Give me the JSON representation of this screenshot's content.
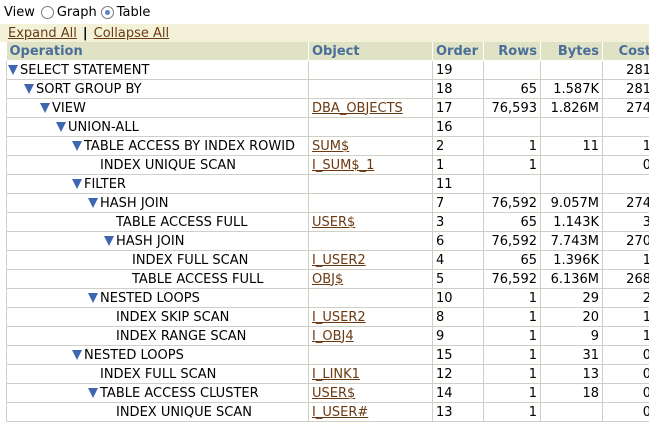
{
  "view": {
    "label": "View",
    "options": [
      {
        "label": "Graph",
        "selected": false
      },
      {
        "label": "Table",
        "selected": true
      }
    ]
  },
  "links": {
    "expand_all": "Expand All",
    "separator": "|",
    "collapse_all": "Collapse All"
  },
  "columns": [
    "Operation",
    "Object",
    "Order",
    "Rows",
    "Bytes",
    "Cost"
  ],
  "rows": [
    {
      "op": "SELECT STATEMENT",
      "depth": 0,
      "expandable": true,
      "object": "",
      "order": "19",
      "rows": "",
      "bytes": "",
      "cost": "281"
    },
    {
      "op": "SORT GROUP BY",
      "depth": 1,
      "expandable": true,
      "object": "",
      "order": "18",
      "rows": "65",
      "bytes": "1.587K",
      "cost": "281"
    },
    {
      "op": "VIEW",
      "depth": 2,
      "expandable": true,
      "object": "DBA_OBJECTS",
      "order": "17",
      "rows": "76,593",
      "bytes": "1.826M",
      "cost": "274"
    },
    {
      "op": "UNION-ALL",
      "depth": 3,
      "expandable": true,
      "object": "",
      "order": "16",
      "rows": "",
      "bytes": "",
      "cost": ""
    },
    {
      "op": "TABLE ACCESS BY INDEX ROWID",
      "depth": 4,
      "expandable": true,
      "object": "SUM$",
      "order": "2",
      "rows": "1",
      "bytes": "11",
      "cost": "1"
    },
    {
      "op": "INDEX UNIQUE SCAN",
      "depth": 5,
      "expandable": false,
      "object": "I_SUM$_1",
      "order": "1",
      "rows": "1",
      "bytes": "",
      "cost": "0"
    },
    {
      "op": "FILTER",
      "depth": 4,
      "expandable": true,
      "object": "",
      "order": "11",
      "rows": "",
      "bytes": "",
      "cost": ""
    },
    {
      "op": "HASH JOIN",
      "depth": 5,
      "expandable": true,
      "object": "",
      "order": "7",
      "rows": "76,592",
      "bytes": "9.057M",
      "cost": "274"
    },
    {
      "op": "TABLE ACCESS FULL",
      "depth": 6,
      "expandable": false,
      "object": "USER$",
      "order": "3",
      "rows": "65",
      "bytes": "1.143K",
      "cost": "3"
    },
    {
      "op": "HASH JOIN",
      "depth": 6,
      "expandable": true,
      "object": "",
      "order": "6",
      "rows": "76,592",
      "bytes": "7.743M",
      "cost": "270"
    },
    {
      "op": "INDEX FULL SCAN",
      "depth": 7,
      "expandable": false,
      "object": "I_USER2",
      "order": "4",
      "rows": "65",
      "bytes": "1.396K",
      "cost": "1"
    },
    {
      "op": "TABLE ACCESS FULL",
      "depth": 7,
      "expandable": false,
      "object": "OBJ$",
      "order": "5",
      "rows": "76,592",
      "bytes": "6.136M",
      "cost": "268"
    },
    {
      "op": "NESTED LOOPS",
      "depth": 5,
      "expandable": true,
      "object": "",
      "order": "10",
      "rows": "1",
      "bytes": "29",
      "cost": "2"
    },
    {
      "op": "INDEX SKIP SCAN",
      "depth": 6,
      "expandable": false,
      "object": "I_USER2",
      "order": "8",
      "rows": "1",
      "bytes": "20",
      "cost": "1"
    },
    {
      "op": "INDEX RANGE SCAN",
      "depth": 6,
      "expandable": false,
      "object": "I_OBJ4",
      "order": "9",
      "rows": "1",
      "bytes": "9",
      "cost": "1"
    },
    {
      "op": "NESTED LOOPS",
      "depth": 4,
      "expandable": true,
      "object": "",
      "order": "15",
      "rows": "1",
      "bytes": "31",
      "cost": "0"
    },
    {
      "op": "INDEX FULL SCAN",
      "depth": 5,
      "expandable": false,
      "object": "I_LINK1",
      "order": "12",
      "rows": "1",
      "bytes": "13",
      "cost": "0"
    },
    {
      "op": "TABLE ACCESS CLUSTER",
      "depth": 5,
      "expandable": true,
      "object": "USER$",
      "order": "14",
      "rows": "1",
      "bytes": "18",
      "cost": "0"
    },
    {
      "op": "INDEX UNIQUE SCAN",
      "depth": 6,
      "expandable": false,
      "object": "I_USER#",
      "order": "13",
      "rows": "1",
      "bytes": "",
      "cost": "0"
    }
  ]
}
